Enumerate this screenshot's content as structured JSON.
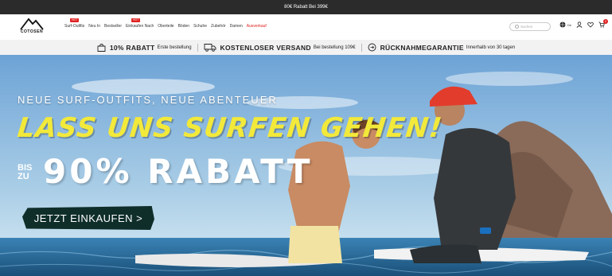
{
  "topbar": {
    "text": "80€ Rabatt Bei 399€"
  },
  "header": {
    "logo_text": "COTOSEN",
    "nav": [
      {
        "label": "Surf-Outfits",
        "badge": "HOT"
      },
      {
        "label": "Neu In"
      },
      {
        "label": "Bestseller"
      },
      {
        "label": "Einkaufen Nach",
        "badge": "HOT"
      },
      {
        "label": "Oberteile"
      },
      {
        "label": "Böden"
      },
      {
        "label": "Schuhe"
      },
      {
        "label": "Zubehör"
      },
      {
        "label": "Damen"
      },
      {
        "label": "Ausverkauf",
        "sale": true
      }
    ],
    "search_placeholder": "Suchen",
    "lang_label": "De",
    "cart_count": "0"
  },
  "promo": {
    "discount_bold": "10% RABATT",
    "discount_text": "Erste bestellung",
    "shipping_bold": "KOSTENLOSER VERSAND",
    "shipping_text": "Bei bestellung 109€",
    "return_bold": "RÜCKNAHMEGARANTIE",
    "return_text": "Innerhalb von 30 tagen"
  },
  "hero": {
    "subtitle": "NEUE SURF-OUTFITS, NEUE ABENTEUER",
    "title": "LASS UNS SURFEN GEHEN!",
    "prefix": "BIS ZU",
    "big": "90% RABATT",
    "cta": "JETZT EINKAUFEN >"
  },
  "colors": {
    "accent": "#e02020",
    "headline_yellow": "#f2e93a",
    "cta_bg": "#0f2e2a"
  }
}
